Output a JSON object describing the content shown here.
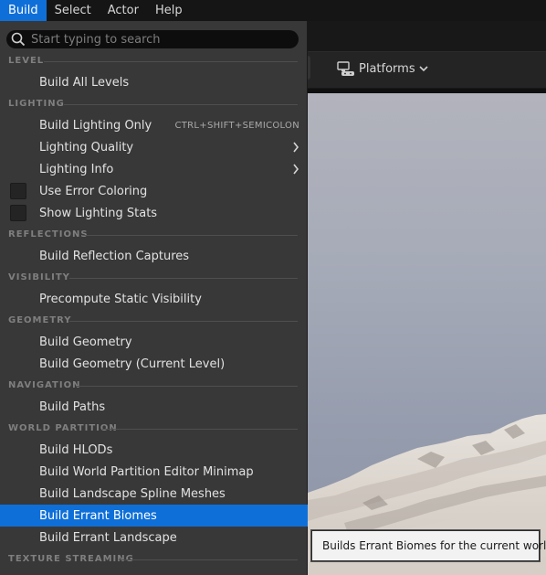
{
  "menubar": {
    "items": [
      {
        "label": "Build"
      },
      {
        "label": "Select"
      },
      {
        "label": "Actor"
      },
      {
        "label": "Help"
      }
    ]
  },
  "toolbar": {
    "platforms_label": "Platforms"
  },
  "build_menu": {
    "search_placeholder": "Start typing to search",
    "sections": {
      "level": "LEVEL",
      "lighting": "LIGHTING",
      "reflections": "REFLECTIONS",
      "visibility": "VISIBILITY",
      "geometry": "GEOMETRY",
      "navigation": "NAVIGATION",
      "world_partition": "WORLD PARTITION",
      "texture_streaming": "TEXTURE STREAMING"
    },
    "items": {
      "build_all_levels": "Build All Levels",
      "build_lighting_only": "Build Lighting Only",
      "build_lighting_only_shortcut": "CTRL+SHIFT+SEMICOLON",
      "lighting_quality": "Lighting Quality",
      "lighting_info": "Lighting Info",
      "use_error_coloring": "Use Error Coloring",
      "show_lighting_stats": "Show Lighting Stats",
      "build_reflection_captures": "Build Reflection Captures",
      "precompute_static_visibility": "Precompute Static Visibility",
      "build_geometry": "Build Geometry",
      "build_geometry_current_level": "Build Geometry (Current Level)",
      "build_paths": "Build Paths",
      "build_hlods": "Build HLODs",
      "build_wp_minimap": "Build World Partition Editor Minimap",
      "build_landscape_spline_meshes": "Build Landscape Spline Meshes",
      "build_errant_biomes": "Build Errant Biomes",
      "build_errant_landscape": "Build Errant Landscape"
    },
    "checkboxes": {
      "use_error_coloring": false,
      "show_lighting_stats": false
    },
    "highlighted_item": "Build Errant Biomes"
  },
  "tooltip": {
    "text": "Builds Errant Biomes for the current world."
  },
  "colors": {
    "accent": "#0f6fd8",
    "menu_bg": "#383838",
    "menubar_bg": "#151515"
  }
}
